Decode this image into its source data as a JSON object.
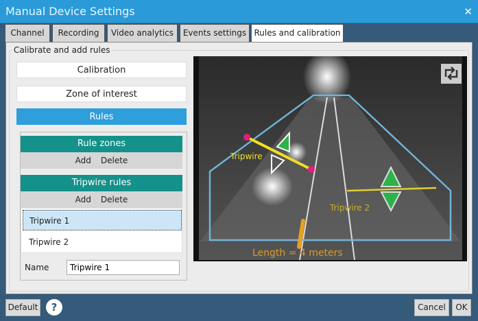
{
  "window": {
    "title": "Manual Device Settings",
    "close_icon": "close-icon"
  },
  "tabs": [
    {
      "label": "Channel"
    },
    {
      "label": "Recording"
    },
    {
      "label": "Video analytics"
    },
    {
      "label": "Events settings"
    },
    {
      "label": "Rules and calibration",
      "active": true
    }
  ],
  "group_label": "Calibrate and add rules",
  "left": {
    "calibration": "Calibration",
    "zone": "Zone of interest",
    "rules": "Rules",
    "rule_zones": {
      "title": "Rule zones",
      "add": "Add",
      "delete": "Delete"
    },
    "tripwire_rules": {
      "title": "Tripwire rules",
      "add": "Add",
      "delete": "Delete",
      "items": [
        "Tripwire 1",
        "Tripwire 2"
      ],
      "selected": 0
    },
    "name_label": "Name",
    "name_value": "Tripwire 1"
  },
  "video": {
    "tripwire1_label": "Tripwire",
    "tripwire2_label": "Tripwire 2",
    "length_label": "Length = 4 meters",
    "zone_color": "#6fb4d8",
    "line_color": "#f0e020",
    "endpoint_color": "#e0207a",
    "arrow_color": "#2db34a",
    "length_color": "#e8a020"
  },
  "footer": {
    "default": "Default",
    "help": "?",
    "cancel": "Cancel",
    "ok": "OK"
  }
}
